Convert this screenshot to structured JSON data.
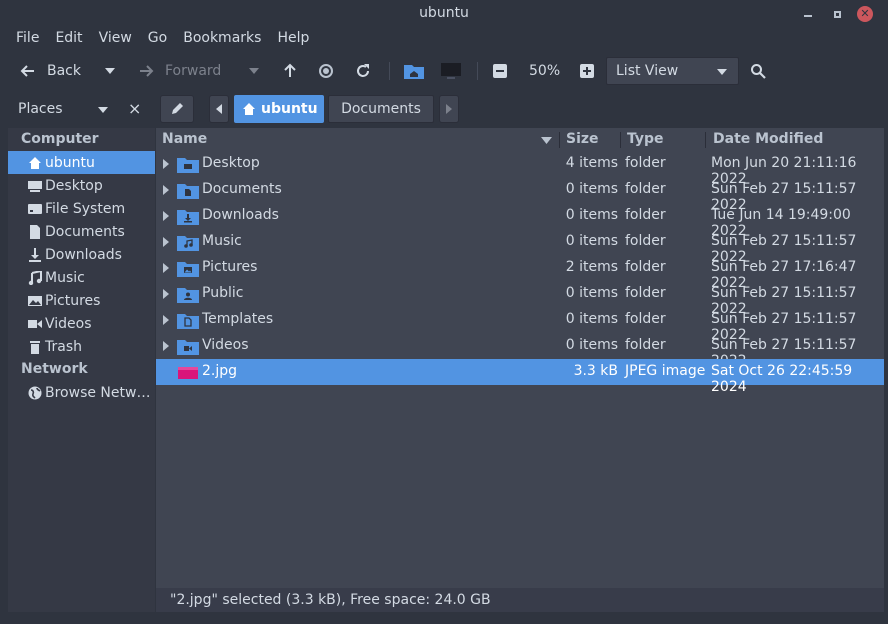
{
  "window": {
    "title": "ubuntu"
  },
  "menu": [
    "File",
    "Edit",
    "View",
    "Go",
    "Bookmarks",
    "Help"
  ],
  "toolbar": {
    "back_label": "Back",
    "forward_label": "Forward",
    "zoom_level": "50%",
    "view_mode": "List View"
  },
  "places": {
    "label": "Places",
    "close": "×"
  },
  "breadcrumb": {
    "home": "ubuntu",
    "next": "Documents"
  },
  "sidebar": {
    "computer_label": "Computer",
    "network_label": "Network",
    "computer_items": [
      {
        "label": "ubuntu",
        "icon": "home-icon"
      },
      {
        "label": "Desktop",
        "icon": "desktop-icon"
      },
      {
        "label": "File System",
        "icon": "drive-icon"
      },
      {
        "label": "Documents",
        "icon": "document-icon"
      },
      {
        "label": "Downloads",
        "icon": "download-icon"
      },
      {
        "label": "Music",
        "icon": "music-icon"
      },
      {
        "label": "Pictures",
        "icon": "picture-icon"
      },
      {
        "label": "Videos",
        "icon": "video-icon"
      },
      {
        "label": "Trash",
        "icon": "trash-icon"
      }
    ],
    "network_items": [
      {
        "label": "Browse Netw…",
        "icon": "globe-icon"
      }
    ]
  },
  "columns": {
    "name": "Name",
    "size": "Size",
    "type": "Type",
    "date": "Date Modified"
  },
  "files": [
    {
      "name": "Desktop",
      "size": "4 items",
      "type": "folder",
      "date": "Mon Jun 20 21:11:16 2022",
      "emblem": "desktop"
    },
    {
      "name": "Documents",
      "size": "0 items",
      "type": "folder",
      "date": "Sun Feb 27 15:11:57 2022",
      "emblem": "document"
    },
    {
      "name": "Downloads",
      "size": "0 items",
      "type": "folder",
      "date": "Tue Jun 14 19:49:00 2022",
      "emblem": "download"
    },
    {
      "name": "Music",
      "size": "0 items",
      "type": "folder",
      "date": "Sun Feb 27 15:11:57 2022",
      "emblem": "music"
    },
    {
      "name": "Pictures",
      "size": "2 items",
      "type": "folder",
      "date": "Sun Feb 27 17:16:47 2022",
      "emblem": "picture"
    },
    {
      "name": "Public",
      "size": "0 items",
      "type": "folder",
      "date": "Sun Feb 27 15:11:57 2022",
      "emblem": "public"
    },
    {
      "name": "Templates",
      "size": "0 items",
      "type": "folder",
      "date": "Sun Feb 27 15:11:57 2022",
      "emblem": "template"
    },
    {
      "name": "Videos",
      "size": "0 items",
      "type": "folder",
      "date": "Sun Feb 27 15:11:57 2022",
      "emblem": "video"
    },
    {
      "name": "2.jpg",
      "size": "3.3 kB",
      "type": "JPEG image",
      "date": "Sat Oct 26 22:45:59 2024",
      "selected": true,
      "image": true
    }
  ],
  "status": "\"2.jpg\" selected (3.3 kB), Free space: 24.0 GB",
  "colors": {
    "accent": "#5294e2",
    "bg": "#2f343f",
    "view": "#404552",
    "sidebar": "#353945",
    "close": "#cc575d"
  }
}
